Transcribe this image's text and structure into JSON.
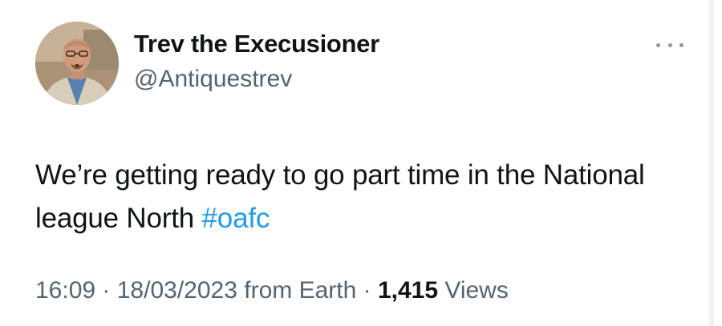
{
  "author": {
    "display_name": "Trev the Execusioner",
    "handle": "@Antiquestrev",
    "avatar_icon": "profile-photo"
  },
  "menu": {
    "icon": "more-horizontal-icon"
  },
  "tweet": {
    "text": "We’re getting ready to go part time in the National league North",
    "hashtag": "#oafc"
  },
  "meta": {
    "time": "16:09",
    "sep1": " · ",
    "date": "18/03/2023",
    "source": " from Earth",
    "sep2": " · ",
    "views_count": "1,415",
    "views_label": " Views"
  },
  "colors": {
    "text": "#0f1419",
    "secondary": "#536471",
    "link": "#1d9bf0"
  }
}
